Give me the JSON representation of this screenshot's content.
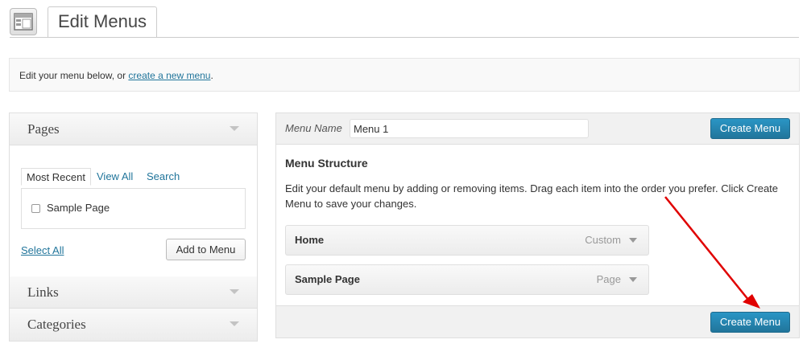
{
  "header": {
    "icon": "menus-layout-icon",
    "title": "Edit Menus"
  },
  "intro": {
    "text_before": "Edit your menu below, or ",
    "link_text": "create a new menu",
    "text_after": "."
  },
  "left": {
    "pages": {
      "title": "Pages",
      "tabs": [
        "Most Recent",
        "View All",
        "Search"
      ],
      "items": [
        {
          "label": "Sample Page",
          "checked": false
        }
      ],
      "select_all": "Select All",
      "add_button": "Add to Menu"
    },
    "links": {
      "title": "Links"
    },
    "categories": {
      "title": "Categories"
    }
  },
  "right": {
    "menu_name_label": "Menu Name",
    "menu_name_value": "Menu 1",
    "create_button_top": "Create Menu",
    "structure_title": "Menu Structure",
    "structure_desc": "Edit your default menu by adding or removing items. Drag each item into the order you prefer. Click Create Menu to save your changes.",
    "items": [
      {
        "title": "Home",
        "type": "Custom"
      },
      {
        "title": "Sample Page",
        "type": "Page"
      }
    ],
    "create_button_bottom": "Create Menu"
  },
  "annotation": {
    "arrow_color": "#e00000",
    "icon": "red-arrow-annotation"
  },
  "colors": {
    "link": "#21759b",
    "primary_button": "#21759b"
  }
}
